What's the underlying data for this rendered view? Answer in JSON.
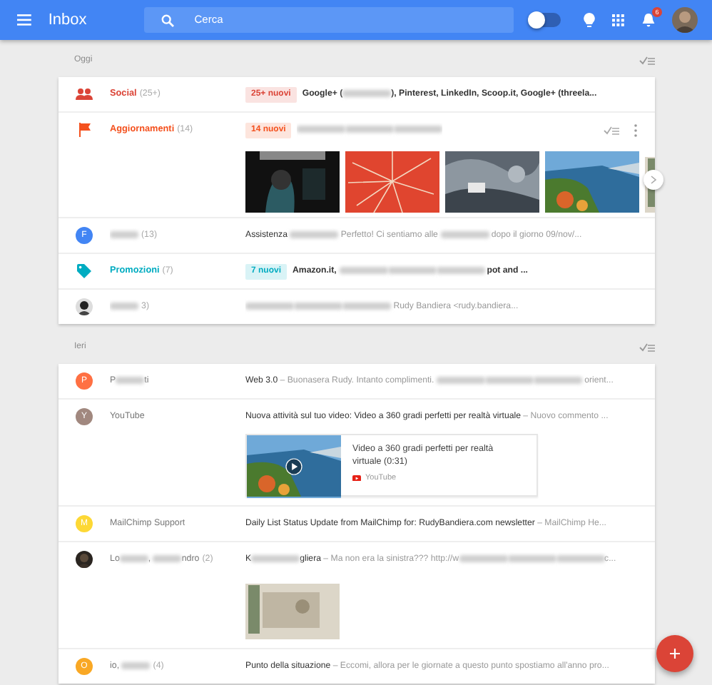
{
  "header": {
    "title": "Inbox",
    "search": {
      "placeholder": "Cerca"
    },
    "pin_toggle": {
      "on": false
    },
    "notifications": {
      "badge": "6"
    }
  },
  "sections": [
    {
      "label": "Oggi",
      "items": [
        {
          "kind": "social",
          "color": "#db4437",
          "name": "Social",
          "count": "(25+)",
          "badge": "25+ nuovi",
          "hover": false,
          "parts": [
            {
              "kind": "strong",
              "text": "Google+ ("
            },
            {
              "kind": "blur"
            },
            {
              "kind": "strong",
              "text": "), Pinterest, LinkedIn, Scoop.it, Google+ (threela..."
            }
          ]
        },
        {
          "kind": "updates",
          "color": "#f4511e",
          "name": "Aggiornamenti",
          "count": "(14)",
          "badge": "14 nuovi",
          "hover": true,
          "parts": [
            {
              "kind": "blur"
            },
            {
              "kind": "blur"
            },
            {
              "kind": "blur"
            }
          ],
          "attachments": [
            {
              "kind": "picture"
            },
            {
              "kind": "picture"
            },
            {
              "kind": "picture"
            },
            {
              "kind": "picture"
            },
            {
              "kind": "picture"
            }
          ]
        },
        {
          "kind": "thread",
          "avatar": {
            "letter": "F",
            "color": "#4285f4"
          },
          "sender": [
            {
              "kind": "blur"
            }
          ],
          "count": "(13)",
          "parts": [
            {
              "kind": "strong",
              "text": "Assistenza "
            },
            {
              "kind": "blur"
            },
            {
              "kind": "text",
              "text": " Perfetto! Ci sentiamo alle "
            },
            {
              "kind": "blur"
            },
            {
              "kind": "text",
              "text": " dopo il giorno 09/nov/..."
            }
          ]
        },
        {
          "kind": "promotions",
          "color": "#00acc1",
          "name": "Promozioni",
          "count": "(7)",
          "badge": "7 nuovi",
          "hover": false,
          "parts": [
            {
              "kind": "strong",
              "text": "Amazon.it, "
            },
            {
              "kind": "blur"
            },
            {
              "kind": "blur"
            },
            {
              "kind": "blur"
            },
            {
              "kind": "strong",
              "text": " pot and ..."
            }
          ]
        },
        {
          "kind": "thread",
          "avatar": {
            "kind": "picture"
          },
          "sender": [
            {
              "kind": "blur"
            }
          ],
          "count": "3)",
          "parts": [
            {
              "kind": "blur"
            },
            {
              "kind": "blur"
            },
            {
              "kind": "blur"
            },
            {
              "kind": "text",
              "text": " Rudy Bandiera <rudy.bandiera..."
            }
          ]
        }
      ]
    },
    {
      "label": "Ieri",
      "items": [
        {
          "kind": "thread",
          "avatar": {
            "letter": "P",
            "color": "#ff7043"
          },
          "sender": [
            {
              "kind": "text",
              "text": "P"
            },
            {
              "kind": "blur"
            },
            {
              "kind": "text",
              "text": "ti"
            }
          ],
          "parts": [
            {
              "kind": "strong",
              "text": "Web 3.0"
            },
            {
              "kind": "text",
              "text": " – Buonasera Rudy. Intanto complimenti. "
            },
            {
              "kind": "blur"
            },
            {
              "kind": "blur"
            },
            {
              "kind": "blur"
            },
            {
              "kind": "text",
              "text": " orient..."
            }
          ]
        },
        {
          "kind": "thread",
          "avatar": {
            "letter": "Y",
            "color": "#a1887f"
          },
          "sender": [
            {
              "kind": "text",
              "text": "YouTube"
            }
          ],
          "parts": [
            {
              "kind": "strong",
              "text": "Nuova attività sul tuo video: Video a 360 gradi perfetti per realtà virtuale"
            },
            {
              "kind": "text",
              "text": " – Nuovo commento ..."
            }
          ],
          "video_card": {
            "title": "Video a 360 gradi perfetti per realtà virtuale (0:31)",
            "source": "YouTube"
          }
        },
        {
          "kind": "thread",
          "avatar": {
            "letter": "M",
            "color": "#fdd835"
          },
          "sender": [
            {
              "kind": "text",
              "text": "MailChimp Support"
            }
          ],
          "parts": [
            {
              "kind": "strong",
              "text": "Daily List Status Update from MailChimp for: RudyBandiera.com newsletter"
            },
            {
              "kind": "text",
              "text": " – MailChimp He..."
            }
          ]
        },
        {
          "kind": "thread",
          "avatar": {
            "kind": "picture"
          },
          "sender": [
            {
              "kind": "text",
              "text": "Lo"
            },
            {
              "kind": "blur"
            },
            {
              "kind": "text",
              "text": ", "
            },
            {
              "kind": "blur"
            },
            {
              "kind": "text",
              "text": "ndro"
            }
          ],
          "count": "(2)",
          "parts": [
            {
              "kind": "strong",
              "text": "K"
            },
            {
              "kind": "blur"
            },
            {
              "kind": "strong",
              "text": "gliera"
            },
            {
              "kind": "text",
              "text": " – Ma non era la sinistra??? http://w"
            },
            {
              "kind": "blur"
            },
            {
              "kind": "blur"
            },
            {
              "kind": "blur"
            },
            {
              "kind": "text",
              "text": "c..."
            }
          ],
          "attachments": [
            {
              "kind": "picture"
            }
          ]
        },
        {
          "kind": "thread",
          "avatar": {
            "letter": "O",
            "color": "#f9a825"
          },
          "sender": [
            {
              "kind": "text",
              "text": "io, "
            },
            {
              "kind": "blur"
            }
          ],
          "count": "(4)",
          "parts": [
            {
              "kind": "strong",
              "text": "Punto della situazione"
            },
            {
              "kind": "text",
              "text": " – Eccomi, allora per le giornate a questo punto spostiamo all'anno pro..."
            }
          ]
        }
      ]
    }
  ]
}
